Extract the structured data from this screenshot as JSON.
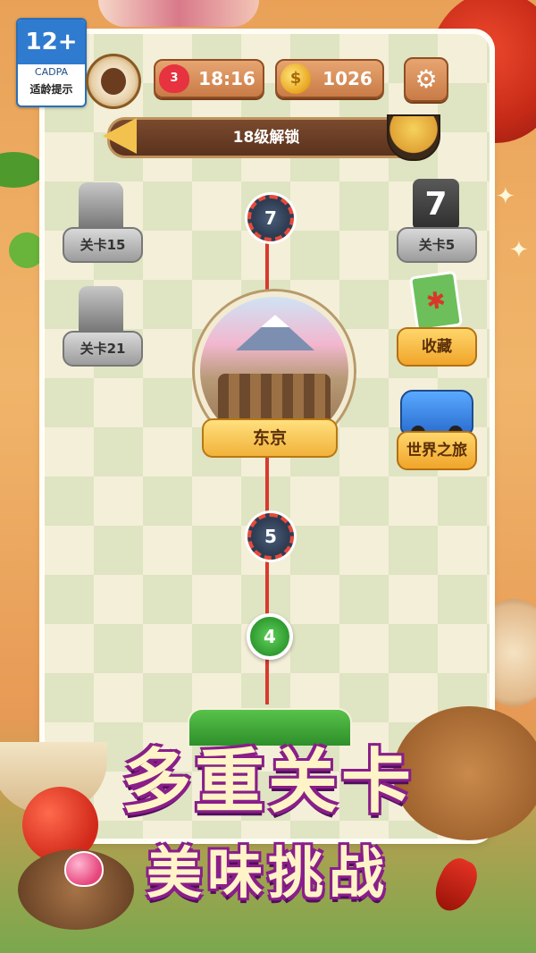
{
  "rating": {
    "age": "12+",
    "org": "CADPA",
    "hint": "适龄提示"
  },
  "status": {
    "lives": "3",
    "timer": "18:16",
    "coins": "1026"
  },
  "unlock_banner": "18级解锁",
  "side_left": [
    {
      "label": "关卡15"
    },
    {
      "label": "关卡21"
    }
  ],
  "side_right": [
    {
      "label": "关卡5",
      "icon_text": "7"
    },
    {
      "label": "收藏"
    },
    {
      "label": "世界之旅"
    }
  ],
  "path": {
    "nodes": [
      {
        "level": "7",
        "state": "locked"
      },
      {
        "level": "5",
        "state": "locked"
      },
      {
        "level": "4",
        "state": "open"
      }
    ],
    "city": "东京"
  },
  "headline": {
    "line1": "多重关卡",
    "line2": "美味挑战"
  },
  "colors": {
    "accent": "#f1b23a",
    "path": "#d93a2e",
    "headline_outline": "#8a1e8a"
  }
}
